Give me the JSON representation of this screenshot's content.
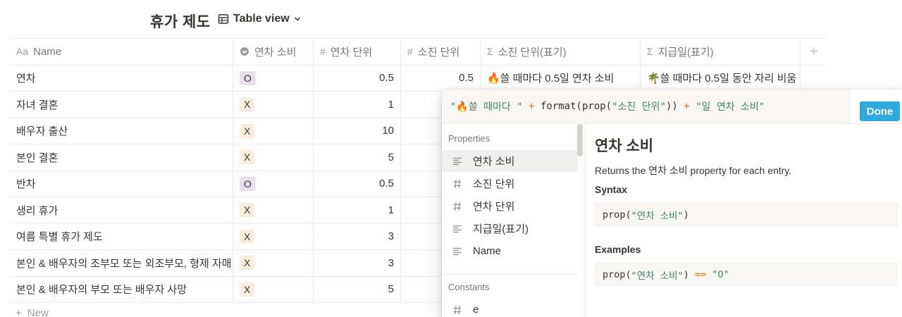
{
  "header": {
    "title": "휴가 제도",
    "view_label": "Table view",
    "view_icon": "table-icon",
    "dropdown_icon": "chevron-down-icon"
  },
  "table": {
    "columns": [
      {
        "icon": "Aa",
        "label": "Name"
      },
      {
        "icon": "select-icon",
        "label": "연차 소비"
      },
      {
        "icon": "#",
        "label": "연차 단위"
      },
      {
        "icon": "#",
        "label": "소진 단위"
      },
      {
        "icon": "Σ",
        "label": "소진 단위(표기)"
      },
      {
        "icon": "Σ",
        "label": "지급일(표기)"
      },
      {
        "icon": "+",
        "label": ""
      }
    ],
    "rows": [
      {
        "name": "연차",
        "used": "O",
        "unit": "0.5",
        "spend": "0.5",
        "spend_fmt": "🔥쓸 때마다 0.5일 연차 소비",
        "pay_fmt": "🌴쓸 때마다 0.5일 동안 자리 비움"
      },
      {
        "name": "자녀 결혼",
        "used": "X",
        "unit": "1",
        "spend": "",
        "spend_fmt": "",
        "pay_fmt": ""
      },
      {
        "name": "배우자 출산",
        "used": "X",
        "unit": "10",
        "spend": "",
        "spend_fmt": "",
        "pay_fmt": ""
      },
      {
        "name": "본인 결혼",
        "used": "X",
        "unit": "5",
        "spend": "",
        "spend_fmt": "",
        "pay_fmt": ""
      },
      {
        "name": "반차",
        "used": "O",
        "unit": "0.5",
        "spend": "",
        "spend_fmt": "",
        "pay_fmt": ""
      },
      {
        "name": "생리 휴가",
        "used": "X",
        "unit": "1",
        "spend": "",
        "spend_fmt": "",
        "pay_fmt": ""
      },
      {
        "name": "여름 특별 휴가 제도",
        "used": "X",
        "unit": "3",
        "spend": "",
        "spend_fmt": "",
        "pay_fmt": ""
      },
      {
        "name": "본인 & 배우자의 조부모 또는 외조부모, 형제 자매",
        "used": "X",
        "unit": "3",
        "spend": "",
        "spend_fmt": "",
        "pay_fmt": ""
      },
      {
        "name": "본인 & 배우자의 부모 또는 배우자 사망",
        "used": "X",
        "unit": "5",
        "spend": "",
        "spend_fmt": "",
        "pay_fmt": ""
      }
    ],
    "new_label": "New"
  },
  "formula": {
    "parts": {
      "s1": "\"🔥쓸 때마다 \"",
      "op1": " + ",
      "fn1": "format(prop(",
      "s2": "\"소진 단위\"",
      "fn2": "))",
      "op2": " + ",
      "s3": "\"일 연차 소비\""
    },
    "done_label": "Done"
  },
  "properties_panel": {
    "properties_label": "Properties",
    "items": [
      {
        "icon": "text-icon",
        "label": "연차 소비"
      },
      {
        "icon": "number-icon",
        "label": "소진 단위"
      },
      {
        "icon": "number-icon",
        "label": "연차 단위"
      },
      {
        "icon": "text-icon",
        "label": "지급일(표기)"
      },
      {
        "icon": "text-icon",
        "label": "Name"
      }
    ],
    "constants_label": "Constants",
    "constants": [
      {
        "icon": "number-icon",
        "label": "e"
      }
    ]
  },
  "doc": {
    "title": "연차 소비",
    "description": "Returns the 연차 소비 property for each entry.",
    "syntax_label": "Syntax",
    "syntax_fn": "prop(",
    "syntax_str": "\"연차 소비\"",
    "syntax_close": ")",
    "examples_label": "Examples",
    "example_fn": "prop(",
    "example_str": "\"연차 소비\"",
    "example_close": ")",
    "example_op": " == ",
    "example_val": "\"O\""
  }
}
